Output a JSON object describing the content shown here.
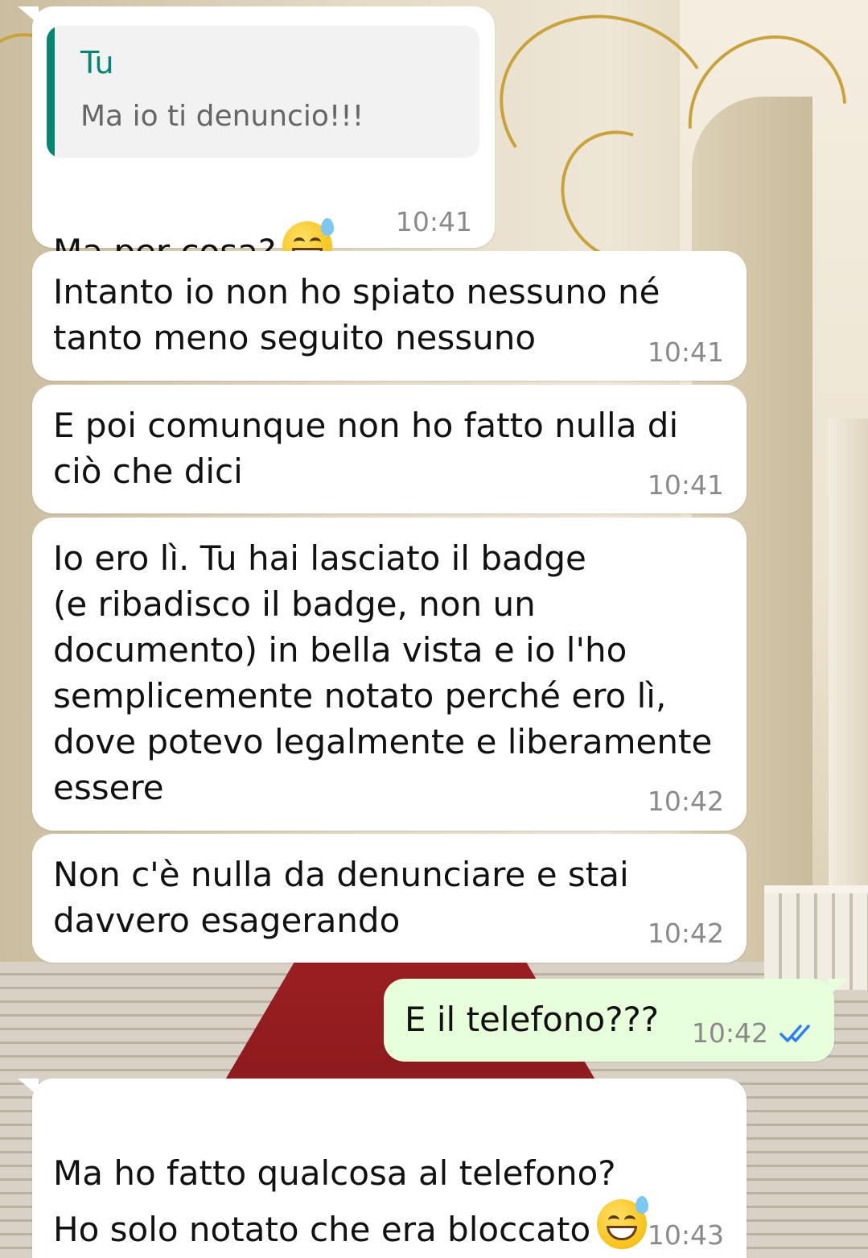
{
  "colors": {
    "incoming_bubble": "#ffffff",
    "outgoing_bubble": "#e7ffdb",
    "quote_accent": "#078473",
    "read_ticks": "#2d7ff0",
    "timestamp": "#8a8a8a"
  },
  "messages": [
    {
      "direction": "incoming",
      "reply_to": {
        "author": "Tu",
        "text": "Ma io ti denuncio!!!"
      },
      "text": "Ma per cosa?",
      "emoji": "grinning-face-with-sweat",
      "time": "10:41"
    },
    {
      "direction": "incoming",
      "text": "Intanto io non ho spiato nessuno né\ntanto meno seguito nessuno",
      "time": "10:41"
    },
    {
      "direction": "incoming",
      "text": "E poi comunque non ho fatto nulla di\nciò che dici",
      "time": "10:41"
    },
    {
      "direction": "incoming",
      "text": "Io ero lì. Tu hai lasciato il badge\n(e ribadisco il badge, non un\ndocumento) in bella vista e io l'ho\nsemplicemente notato perché ero lì,\ndove potevo legalmente e liberamente\nessere",
      "time": "10:42"
    },
    {
      "direction": "incoming",
      "text": "Non c'è nulla da denunciare e stai\ndavvero esagerando",
      "time": "10:42"
    },
    {
      "direction": "outgoing",
      "text": "E il telefono???",
      "time": "10:42",
      "status": "read"
    },
    {
      "direction": "incoming",
      "text": "Ma ho fatto qualcosa al telefono?\nHo solo notato che era bloccato",
      "emoji": "grinning-face-with-sweat",
      "time": "10:43"
    }
  ]
}
